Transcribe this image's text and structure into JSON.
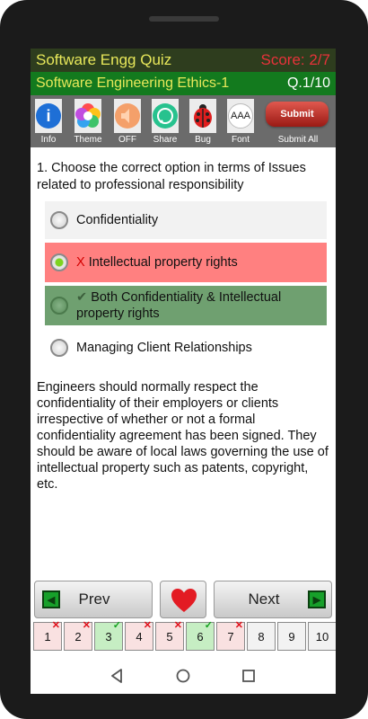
{
  "header": {
    "title": "Software Engg Quiz",
    "score": "Score: 2/7",
    "subtitle": "Software Engineering Ethics-1",
    "question_no": "Q.1/10"
  },
  "toolbar": {
    "info": "Info",
    "theme": "Theme",
    "sound": "OFF",
    "share": "Share",
    "bug": "Bug",
    "font": "Font",
    "font_glyph": "AAA",
    "submit_button": "Submit",
    "submit_all": "Submit All"
  },
  "question": "1. Choose the correct option in terms of Issues related to professional responsibility",
  "options": [
    {
      "mark": "",
      "label": "Confidentiality"
    },
    {
      "mark": "X",
      "label": "Intellectual property rights"
    },
    {
      "mark": "✔",
      "label": "Both Confidentiality & Intellectual property rights"
    },
    {
      "mark": "",
      "label": "Managing Client Relationships"
    }
  ],
  "explanation": "Engineers should normally respect the confidentiality of their employers or clients irrespective of whether or not a formal confidentiality agreement has been signed. They should be aware of local laws governing the use of intellectual property such as patents, copyright, etc.",
  "navigation": {
    "prev": "Prev",
    "next": "Next"
  },
  "pager": [
    {
      "num": "1",
      "mark": "✕"
    },
    {
      "num": "2",
      "mark": "✕"
    },
    {
      "num": "3",
      "mark": "✓"
    },
    {
      "num": "4",
      "mark": "✕"
    },
    {
      "num": "5",
      "mark": "✕"
    },
    {
      "num": "6",
      "mark": "✓"
    },
    {
      "num": "7",
      "mark": "✕"
    },
    {
      "num": "8",
      "mark": ""
    },
    {
      "num": "9",
      "mark": ""
    },
    {
      "num": "10",
      "mark": ""
    }
  ],
  "colors": {
    "wrong_option": "#ff8080",
    "correct_option": "#6fa070",
    "header_green": "#137a1e",
    "score_red": "#e8323a",
    "pager_wrong": "#f9e1e1",
    "pager_correct": "#c6eec3"
  }
}
